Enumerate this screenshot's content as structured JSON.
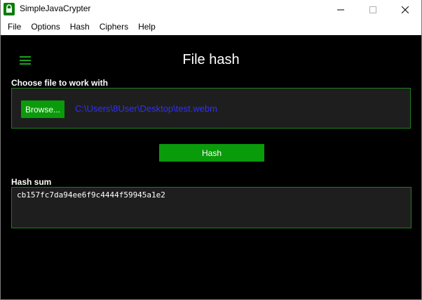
{
  "window": {
    "title": "SimpleJavaCrypter",
    "icon": "padlock-icon",
    "accent_color": "#0a9b0a"
  },
  "menu": {
    "items": [
      "File",
      "Options",
      "Hash",
      "Ciphers",
      "Help"
    ]
  },
  "page": {
    "title": "File hash"
  },
  "file_section": {
    "label": "Choose file to work with",
    "browse_label": "Browse...",
    "file_path": "C:\\Users\\8User\\Desktop\\test.webm"
  },
  "hash_button": {
    "label": "Hash"
  },
  "hash_section": {
    "label": "Hash sum",
    "value": "cb157fc7da94ee6f9c4444f59945a1e2"
  }
}
